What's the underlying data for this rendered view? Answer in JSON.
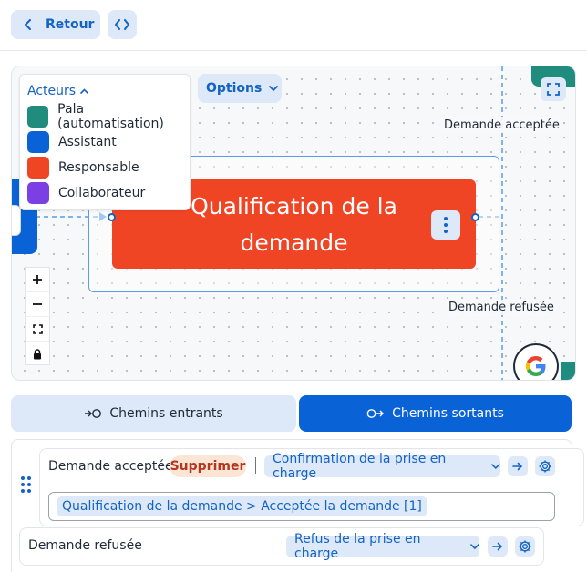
{
  "toolbar": {
    "back_label": "Retour"
  },
  "canvas": {
    "options_label": "Options",
    "legend": {
      "title": "Acteurs",
      "items": [
        {
          "label": "Pala (automatisation)",
          "color": "#1f8c7e"
        },
        {
          "label": "Assistant",
          "color": "#0a63d6"
        },
        {
          "label": "Responsable",
          "color": "#f04525"
        },
        {
          "label": "Collaborateur",
          "color": "#7b3fe4"
        }
      ]
    },
    "main_node": {
      "title_line1": "Qualification de la",
      "title_line2": "demande",
      "color": "#f04525"
    },
    "edge_labels": {
      "accepted": "Demande acceptée",
      "refused": "Demande refusée"
    }
  },
  "tabs": {
    "incoming": "Chemins entrants",
    "outgoing": "Chemins sortants"
  },
  "paths": [
    {
      "name": "Demande acceptée",
      "delete_label": "Supprimer",
      "target": "Confirmation de la prise en charge",
      "condition": "Qualification de la demande > Acceptée la demande [1]"
    },
    {
      "name": "Demande refusée",
      "target": "Refus de la prise en charge"
    }
  ],
  "colors": {
    "accent": "#1463c4",
    "accent_bg": "#dde9f8",
    "primary": "#0a63d6"
  }
}
